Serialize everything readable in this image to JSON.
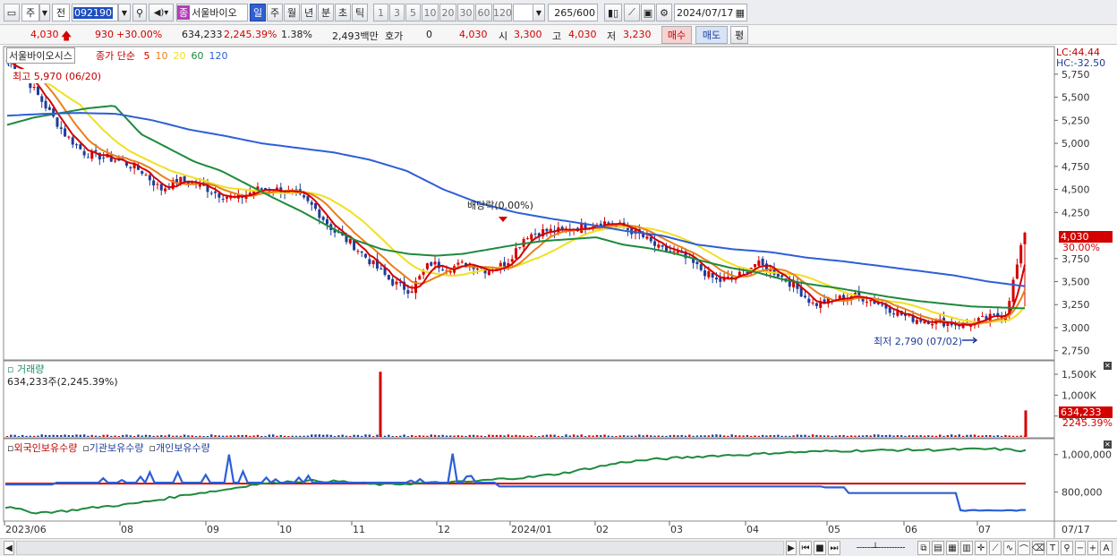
{
  "toolbar": {
    "market": "주",
    "stock_code": "092190",
    "stock_name": "서울바이오",
    "prev": "전",
    "periods": [
      "일",
      "주",
      "월",
      "년",
      "분",
      "초",
      "틱"
    ],
    "active_period": "일",
    "intervals": [
      "1",
      "3",
      "5",
      "10",
      "20",
      "30",
      "60",
      "120"
    ],
    "count": "265",
    "count_max": "/600",
    "date": "2024/07/17",
    "jong": "종"
  },
  "quote": {
    "price": "4,030",
    "change": "930",
    "rate": "+30.00%",
    "volume": "634,233",
    "vol_rate": "2,245.39%",
    "turnover_pct": "1.38%",
    "amount": "2,493백만",
    "hoga_label": "호가",
    "hoga_val": "0",
    "hoga_price": "4,030",
    "open_label": "시",
    "open": "3,300",
    "high_label": "고",
    "high": "4,030",
    "low_label": "저",
    "low": "3,230",
    "buy": "매수",
    "sell": "매도",
    "pyeong": "평"
  },
  "panel_price": {
    "name": "서울바이오시스",
    "ma_title": "종가 단순",
    "ma_periods": [
      "5",
      "10",
      "20",
      "60",
      "120"
    ],
    "ma_colors": [
      "#d40000",
      "#e8801a",
      "#f0e020",
      "#1e8a3c",
      "#2d5fd6"
    ],
    "high_note": "최고 5,970 (06/20)",
    "low_note": "최저 2,790 (07/02)",
    "dividend": "배당락(0.00%)",
    "lc": "LC:44.44",
    "hc": "HC:-32.50",
    "last": "4,030",
    "last_rate": "30.00%",
    "yticks": [
      "5,750",
      "5,500",
      "5,250",
      "5,000",
      "4,750",
      "4,500",
      "4,250",
      "3,750",
      "3,500",
      "3,250",
      "3,000",
      "2,750"
    ]
  },
  "panel_volume": {
    "title": "거래량",
    "sub": "634,233주(2,245.39%)",
    "yticks": [
      "1,500K",
      "1,000K",
      "500K"
    ],
    "last": "634,233",
    "last_rate": "2245.39%"
  },
  "panel_holdings": {
    "items": [
      "외국인보유수량",
      "기관보유수량",
      "개인보유수량"
    ],
    "colors": [
      "#2d5fd6",
      "#d40000",
      "#1e8a3c"
    ],
    "yticks": [
      "1,000,000",
      "800,000"
    ]
  },
  "xaxis": [
    "2023/06",
    "08",
    "09",
    "10",
    "11",
    "12",
    "2024/01",
    "02",
    "03",
    "04",
    "05",
    "06",
    "07"
  ],
  "xend": "07/17",
  "chart_data": [
    {
      "type": "candlestick",
      "x_range": [
        "2023/06",
        "2024/07/17"
      ],
      "y_range": [
        2650,
        6050
      ],
      "series": [
        {
          "name": "5",
          "values": []
        },
        {
          "name": "10",
          "values": []
        },
        {
          "name": "20",
          "values": []
        },
        {
          "name": "60",
          "values": []
        },
        {
          "name": "120",
          "values": []
        }
      ],
      "price_path": [
        5900,
        5700,
        5400,
        5100,
        4900,
        4850,
        4800,
        4700,
        4500,
        4600,
        4550,
        4450,
        4400,
        4500,
        4500,
        4450,
        4300,
        4050,
        3900,
        3700,
        3500,
        3400,
        3700,
        3650,
        3700,
        3620,
        3700,
        4000,
        4050,
        4050,
        4100,
        4150,
        4100,
        4000,
        3850,
        3800,
        3650,
        3500,
        3550,
        3700,
        3600,
        3450,
        3250,
        3300,
        3350,
        3300,
        3200,
        3100,
        3080,
        3050,
        3030,
        3100,
        3150,
        4030
      ],
      "ma20": [
        5900,
        5600,
        5200,
        4950,
        4800,
        4650,
        4580,
        4550,
        4520,
        4500,
        4450,
        4350,
        4150,
        3950,
        3850,
        3800,
        3720,
        3700,
        3700,
        3720,
        3800,
        3900,
        3980,
        4020,
        4100,
        4120,
        4050,
        3950,
        3850,
        3750,
        3650,
        3600,
        3590,
        3560,
        3450,
        3400,
        3340,
        3290,
        3250,
        3200,
        3150,
        3130,
        3110,
        3100,
        3110,
        3200
      ],
      "ma60": [
        5200,
        5280,
        5330,
        5380,
        5410,
        5100,
        4950,
        4800,
        4700,
        4550,
        4400,
        4260,
        4100,
        3950,
        3850,
        3800,
        3780,
        3800,
        3850,
        3900,
        3940,
        3960,
        3980,
        3900,
        3860,
        3800,
        3720,
        3650,
        3600,
        3520,
        3470,
        3430,
        3380,
        3330,
        3290,
        3260,
        3230,
        3220,
        3210
      ],
      "ma120": [
        5300,
        5320,
        5330,
        5320,
        5250,
        5150,
        5080,
        5000,
        4950,
        4900,
        4820,
        4700,
        4500,
        4350,
        4250,
        4180,
        4120,
        4050,
        4000,
        3900,
        3850,
        3820,
        3760,
        3720,
        3670,
        3620,
        3570,
        3500,
        3450
      ]
    },
    {
      "type": "bar",
      "name": "거래량",
      "y_range": [
        0,
        1800
      ],
      "spikes": [
        {
          "x": "2023/11",
          "value": 1560
        },
        {
          "x": "2024/07/17",
          "value": 634
        }
      ]
    },
    {
      "type": "line",
      "name": "보유수량",
      "y_range": [
        650000,
        1080000
      ],
      "series": [
        {
          "name": "외국인보유수량"
        },
        {
          "name": "기관보유수량"
        },
        {
          "name": "개인보유수량"
        }
      ]
    }
  ]
}
